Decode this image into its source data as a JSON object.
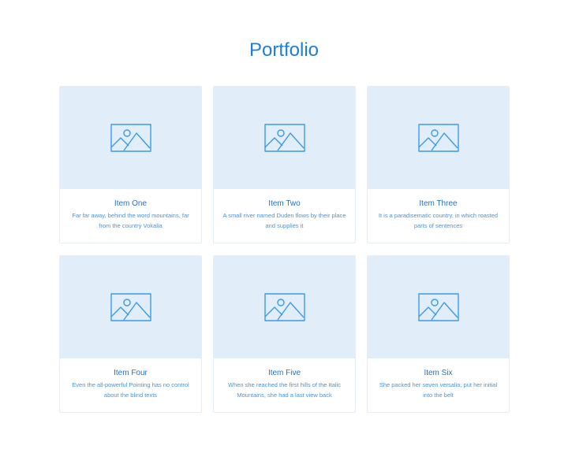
{
  "page": {
    "title": "Portfolio"
  },
  "items": [
    {
      "title": "Item One",
      "desc": "Far far away, behind the word mountains, far from the country Vokalia",
      "icon": "image-placeholder-icon"
    },
    {
      "title": "Item Two",
      "desc": "A small river named Duden flows by their place and supplies it",
      "icon": "image-placeholder-icon"
    },
    {
      "title": "Item Three",
      "desc": "It is a paradisematic country, in which roasted parts of sentences",
      "icon": "image-placeholder-icon"
    },
    {
      "title": "Item Four",
      "desc": "Even the all-powerful Pointing has no control about the blind texts",
      "icon": "image-placeholder-icon"
    },
    {
      "title": "Item Five",
      "desc": "When she reached the first hills of the Italic Mountains, she had a last view back",
      "icon": "image-placeholder-icon"
    },
    {
      "title": "Item Six",
      "desc": "She packed her seven versalia, put her initial into the belt",
      "icon": "image-placeholder-icon"
    }
  ],
  "colors": {
    "accent": "#1e7ed6",
    "thumb_bg": "#e1eefa",
    "icon_stroke": "#3a9ae6"
  }
}
